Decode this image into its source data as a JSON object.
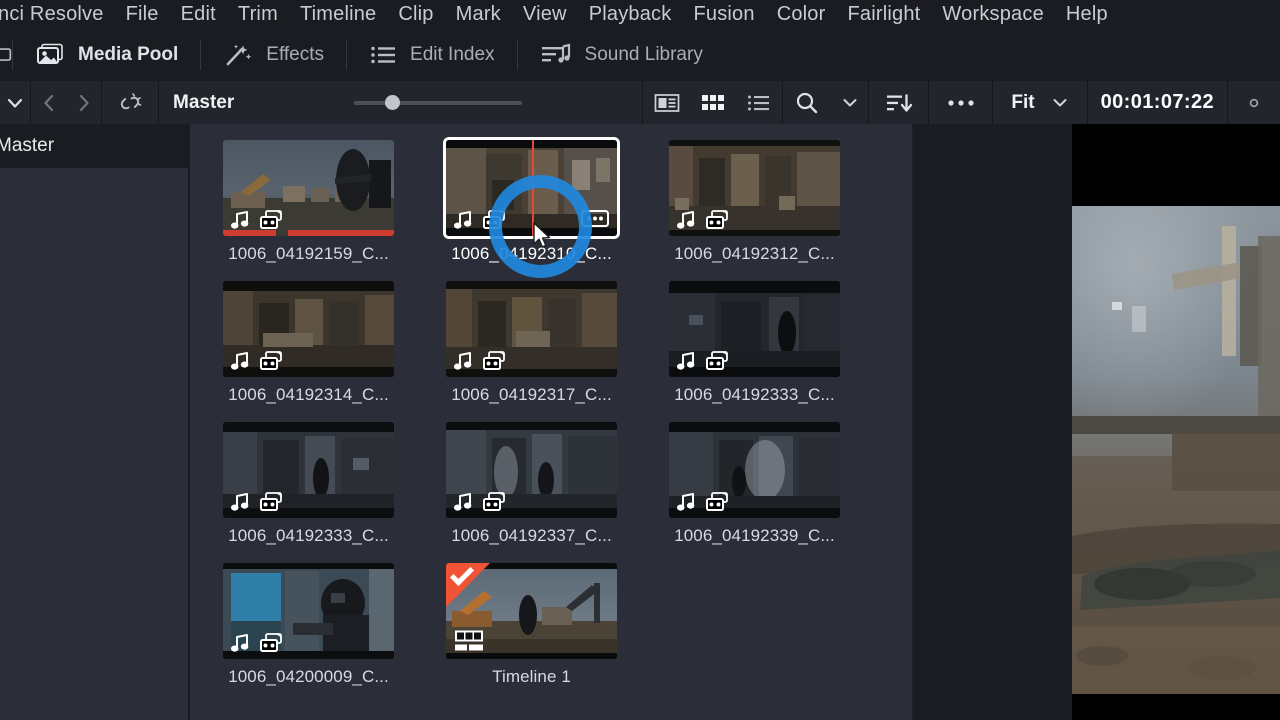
{
  "app": {
    "name": "DaVinci Resolve"
  },
  "menubar": {
    "items": [
      {
        "label": "nci Resolve",
        "name": "menu-resolve"
      },
      {
        "label": "File",
        "name": "menu-file"
      },
      {
        "label": "Edit",
        "name": "menu-edit"
      },
      {
        "label": "Trim",
        "name": "menu-trim"
      },
      {
        "label": "Timeline",
        "name": "menu-timeline"
      },
      {
        "label": "Clip",
        "name": "menu-clip"
      },
      {
        "label": "Mark",
        "name": "menu-mark"
      },
      {
        "label": "View",
        "name": "menu-view"
      },
      {
        "label": "Playback",
        "name": "menu-playback"
      },
      {
        "label": "Fusion",
        "name": "menu-fusion"
      },
      {
        "label": "Color",
        "name": "menu-color"
      },
      {
        "label": "Fairlight",
        "name": "menu-fairlight"
      },
      {
        "label": "Workspace",
        "name": "menu-workspace"
      },
      {
        "label": "Help",
        "name": "menu-help"
      }
    ]
  },
  "pagebar": {
    "tabs": [
      {
        "label": "Media Pool",
        "icon": "media-pool-icon",
        "active": true
      },
      {
        "label": "Effects",
        "icon": "effects-wand-icon",
        "active": false
      },
      {
        "label": "Edit Index",
        "icon": "edit-index-list-icon",
        "active": false
      },
      {
        "label": "Sound Library",
        "icon": "sound-library-icon",
        "active": false
      }
    ]
  },
  "poolbar": {
    "dropdown_icon": "chevron-down-icon",
    "back_icon": "chevron-left-icon",
    "forward_icon": "chevron-right-icon",
    "link_icon": "broken-link-icon",
    "title": "Master",
    "zoom_slider": {
      "value": 23,
      "min": 0,
      "max": 100
    },
    "view_metadata_icon": "metadata-view-icon",
    "view_thumbnail_icon": "thumbnail-view-icon",
    "view_list_icon": "list-view-icon",
    "search_icon": "search-icon",
    "search_chevron_icon": "chevron-down-icon",
    "sort_icon": "sort-descending-icon",
    "options_icon": "more-options-icon",
    "fit_label": "Fit",
    "fit_chevron_icon": "chevron-down-icon",
    "timecode": "00:01:07:22",
    "record_icon": "record-dot-icon"
  },
  "sidebar": {
    "items": [
      {
        "label": "Master",
        "name": "bin-master",
        "selected": true
      }
    ]
  },
  "pool": {
    "clips": [
      {
        "label": "1006_04192159_C...",
        "selected": false,
        "audio": true,
        "camera": true,
        "used_ranges": true,
        "options_badge": false,
        "playhead": false,
        "timeline": false
      },
      {
        "label": "1006_04192310_C...",
        "selected": true,
        "audio": true,
        "camera": true,
        "used_ranges": false,
        "options_badge": true,
        "playhead": true,
        "timeline": false
      },
      {
        "label": "1006_04192312_C...",
        "selected": false,
        "audio": true,
        "camera": true,
        "used_ranges": false,
        "options_badge": false,
        "playhead": false,
        "timeline": false
      },
      {
        "label": "1006_04192314_C...",
        "selected": false,
        "audio": true,
        "camera": true,
        "used_ranges": false,
        "options_badge": false,
        "playhead": false,
        "timeline": false
      },
      {
        "label": "1006_04192317_C...",
        "selected": false,
        "audio": true,
        "camera": true,
        "used_ranges": false,
        "options_badge": false,
        "playhead": false,
        "timeline": false
      },
      {
        "label": "1006_04192333_C...",
        "selected": false,
        "audio": true,
        "camera": true,
        "used_ranges": false,
        "options_badge": false,
        "playhead": false,
        "timeline": false
      },
      {
        "label": "1006_04192333_C...",
        "selected": false,
        "audio": true,
        "camera": true,
        "used_ranges": false,
        "options_badge": false,
        "playhead": false,
        "timeline": false
      },
      {
        "label": "1006_04192337_C...",
        "selected": false,
        "audio": true,
        "camera": true,
        "used_ranges": false,
        "options_badge": false,
        "playhead": false,
        "timeline": false
      },
      {
        "label": "1006_04192339_C...",
        "selected": false,
        "audio": true,
        "camera": true,
        "used_ranges": false,
        "options_badge": false,
        "playhead": false,
        "timeline": false
      },
      {
        "label": "1006_04200009_C...",
        "selected": false,
        "audio": true,
        "camera": true,
        "used_ranges": false,
        "options_badge": false,
        "playhead": false,
        "timeline": false
      },
      {
        "label": "Timeline 1",
        "selected": false,
        "audio": false,
        "camera": false,
        "used_ranges": false,
        "options_badge": false,
        "playhead": false,
        "timeline": true
      }
    ]
  },
  "viewer": {
    "name": "source-viewer"
  },
  "colors": {
    "accent_blue": "#2188dd",
    "playhead_red": "#e8453c",
    "used_range_red": "#cf3c30",
    "timeline_flag_orange": "#f05434",
    "panel_bg": "#2b2e38",
    "chrome_bg": "#1b1c21",
    "poolbar_bg": "#23252c"
  }
}
